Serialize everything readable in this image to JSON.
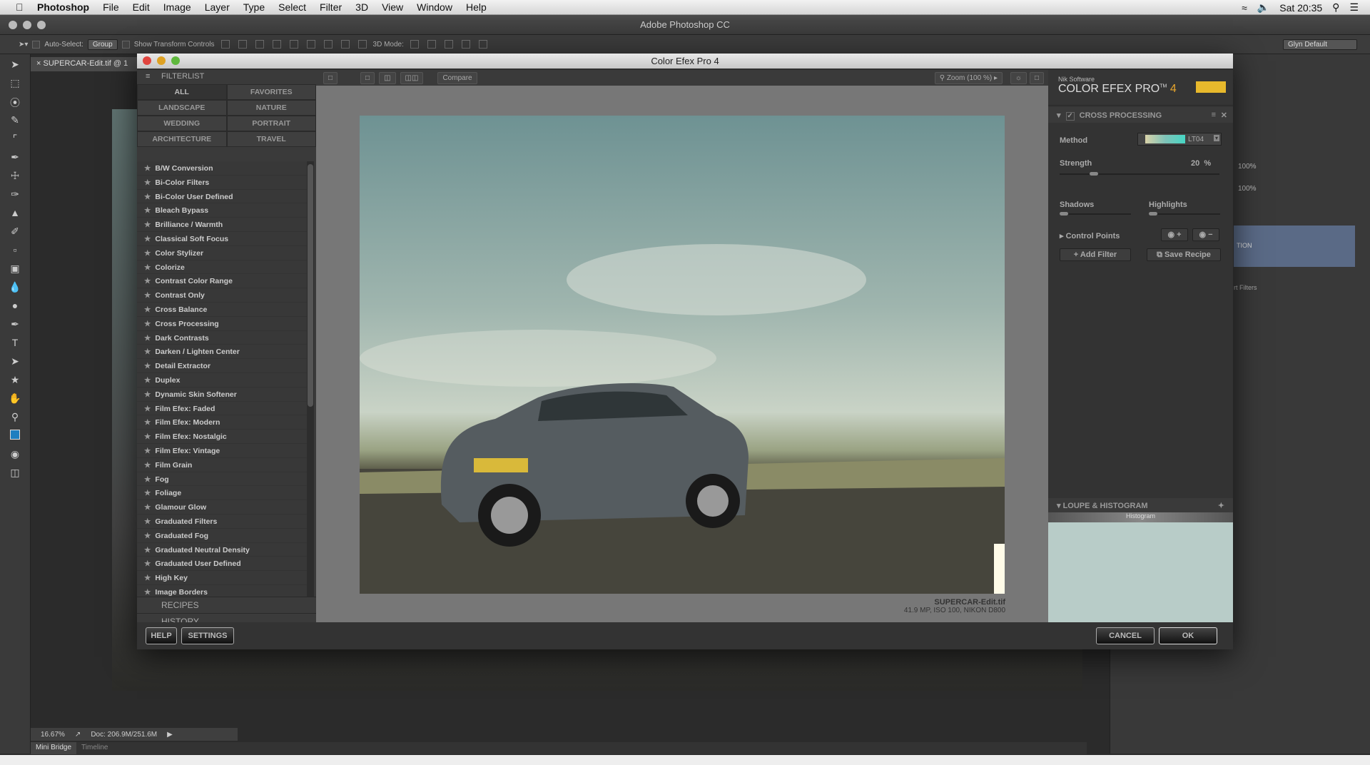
{
  "menubar": {
    "app": "Photoshop",
    "items": [
      "File",
      "Edit",
      "Image",
      "Layer",
      "Type",
      "Select",
      "Filter",
      "3D",
      "View",
      "Window",
      "Help"
    ],
    "clock": "Sat 20:35"
  },
  "ps": {
    "title": "Adobe Photoshop CC",
    "auto_select": "Auto-Select:",
    "auto_select_value": "Group",
    "show_transform": "Show Transform Controls",
    "mode_3d": "3D Mode:",
    "workspace": "Glyn Default",
    "doc_tab": "SUPERCAR-Edit.tif @ 1",
    "zoom": "16.67%",
    "doc_size": "Doc: 206.9M/251.6M",
    "bottom_tabs": [
      "Mini Bridge",
      "Timeline"
    ],
    "layer_opacity": "100%",
    "layer_fill": "100%",
    "layer_name_fragment": "TION",
    "smart_filters_fragment": "rt Filters"
  },
  "dialog": {
    "title": "Color Efex Pro 4",
    "filterlist": {
      "header": "FILTERLIST",
      "categories": [
        "ALL",
        "FAVORITES",
        "LANDSCAPE",
        "NATURE",
        "WEDDING",
        "PORTRAIT",
        "ARCHITECTURE",
        "TRAVEL"
      ],
      "active_category": "ALL",
      "filters": [
        "B/W Conversion",
        "Bi-Color Filters",
        "Bi-Color User Defined",
        "Bleach Bypass",
        "Brilliance / Warmth",
        "Classical Soft Focus",
        "Color Stylizer",
        "Colorize",
        "Contrast Color Range",
        "Contrast Only",
        "Cross Balance",
        "Cross Processing",
        "Dark Contrasts",
        "Darken / Lighten Center",
        "Detail Extractor",
        "Duplex",
        "Dynamic Skin Softener",
        "Film Efex: Faded",
        "Film Efex: Modern",
        "Film Efex: Nostalgic",
        "Film Efex: Vintage",
        "Film Grain",
        "Fog",
        "Foliage",
        "Glamour Glow",
        "Graduated Filters",
        "Graduated Fog",
        "Graduated Neutral Density",
        "Graduated User Defined",
        "High Key",
        "Image Borders"
      ],
      "recipes": "RECIPES",
      "history": "HISTORY"
    },
    "preview": {
      "compare": "Compare",
      "zoom": "Zoom (100 %)",
      "filename": "SUPERCAR-Edit.tif",
      "meta": "41.9 MP, ISO 100, NIKON D800"
    },
    "right": {
      "vendor": "Nik Software",
      "product": "COLOR EFEX PRO",
      "tm": "TM",
      "version": "4",
      "filter_name": "CROSS PROCESSING",
      "filter_enabled": true,
      "method_label": "Method",
      "method_value": "LT04",
      "strength_label": "Strength",
      "strength_value": "20",
      "strength_unit": "%",
      "strength": 20,
      "shadows_label": "Shadows",
      "shadows": 0,
      "highlights_label": "Highlights",
      "highlights": 0,
      "control_points": "Control Points",
      "add_filter": "+ Add Filter",
      "save_recipe": "Save Recipe",
      "loupe": "LOUPE & HISTOGRAM",
      "histogram": "Histogram"
    },
    "help": "HELP",
    "settings": "SETTINGS",
    "cancel": "CANCEL",
    "ok": "OK"
  },
  "colors": {
    "panel": "#3a3a3a",
    "photo_sky": "#6e9293",
    "loupe": "#b8ccc8"
  }
}
